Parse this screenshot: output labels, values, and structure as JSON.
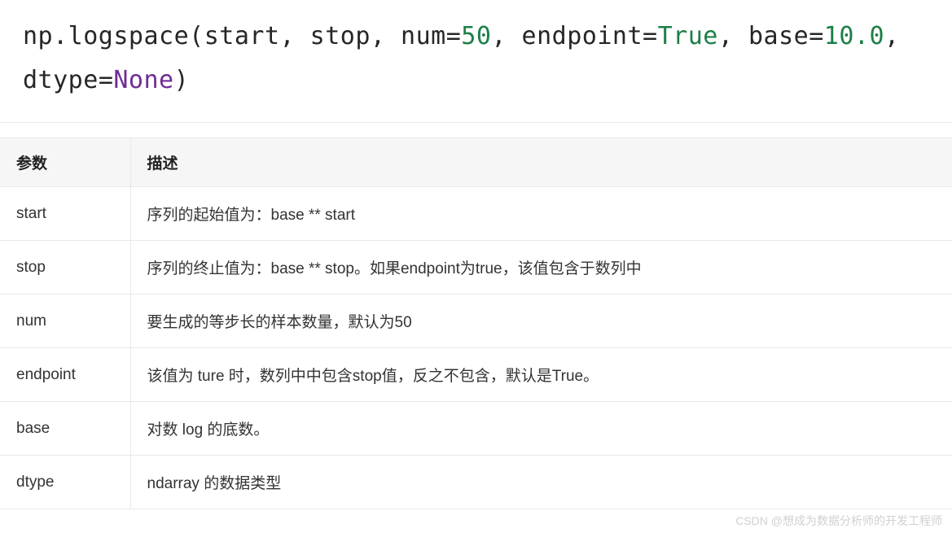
{
  "code": {
    "prefix1": "np.logspace(start, stop, num",
    "eq1": "=",
    "val1": "50",
    "sep1": ", endpoint",
    "eq2": "=",
    "val2": "True",
    "sep2": ", base",
    "eq3": "=",
    "val3": "10.0",
    "sep3": ", dtype",
    "eq4": "=",
    "val4": "None",
    "suffix": ")"
  },
  "table": {
    "header": {
      "col1": "参数",
      "col2": "描述"
    },
    "rows": [
      {
        "param": "start",
        "desc": "序列的起始值为：base ** start"
      },
      {
        "param": "stop",
        "desc": "序列的终止值为：base ** stop。如果endpoint为true，该值包含于数列中"
      },
      {
        "param": "num",
        "desc": "要生成的等步长的样本数量，默认为50"
      },
      {
        "param": "endpoint",
        "desc": "该值为 ture 时，数列中中包含stop值，反之不包含，默认是True。"
      },
      {
        "param": "base",
        "desc": "对数 log 的底数。"
      },
      {
        "param": "dtype",
        "desc": "ndarray 的数据类型"
      }
    ]
  },
  "watermark": "CSDN @想成为数据分析师的开发工程师"
}
